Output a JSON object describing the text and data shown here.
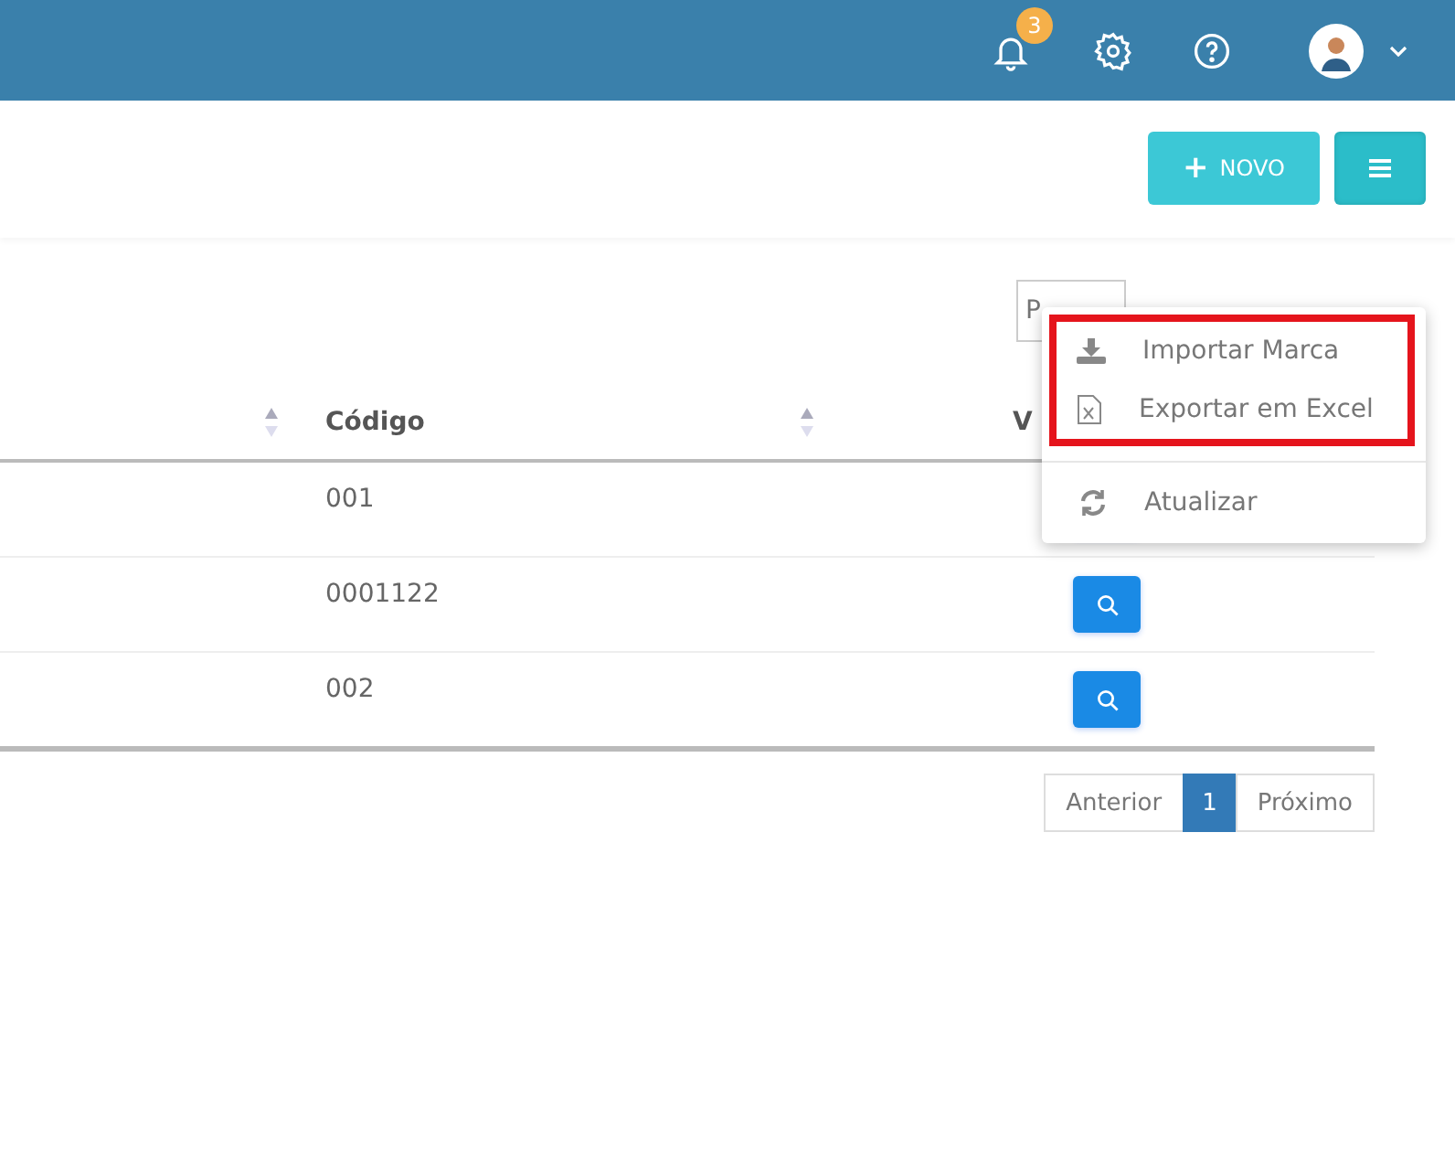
{
  "header": {
    "notifications": {
      "count": "3"
    }
  },
  "toolbar": {
    "new_button": {
      "icon": "+",
      "label": "NOVO"
    },
    "menu_button": {
      "expanded": true
    }
  },
  "dropdown": {
    "sections": [
      {
        "highlighted": true,
        "items": [
          {
            "kind": "download",
            "label": "Importar Marca"
          },
          {
            "kind": "excel",
            "label": "Exportar em Excel"
          }
        ]
      },
      {
        "highlighted": false,
        "items": [
          {
            "kind": "refresh",
            "label": "Atualizar"
          }
        ]
      }
    ]
  },
  "search": {
    "placeholder": "P"
  },
  "table": {
    "columns": [
      {
        "sortable": true
      },
      {
        "label": "Código",
        "sortable": true
      },
      {
        "label": "V"
      }
    ],
    "rows": [
      {
        "code": "001"
      },
      {
        "code": "0001122"
      },
      {
        "code": "002"
      }
    ]
  },
  "pagination": {
    "previous": "Anterior",
    "pages": [
      {
        "label": "1",
        "selected": true
      }
    ],
    "next": "Próximo"
  }
}
